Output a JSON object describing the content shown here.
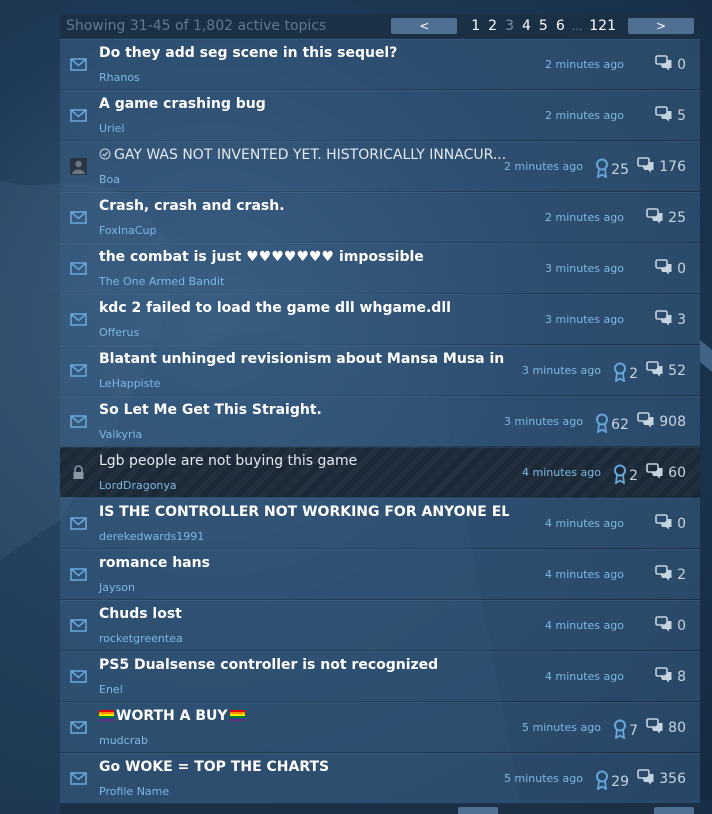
{
  "paging": {
    "summary": "Showing 31-45 of 1,802 active topics",
    "prev_label": "<",
    "next_label": ">",
    "pages": [
      "1",
      "2",
      "3",
      "4",
      "5",
      "6"
    ],
    "current_page": "3",
    "ellipsis": "...",
    "last_page": "121"
  },
  "colors": {
    "accent": "#4f6f93",
    "link": "#7fb8e0",
    "row_bg": "#385e85"
  },
  "topics": [
    {
      "icon": "envelope-icon",
      "title": "Do they add seg scene in this sequel?",
      "author": "Rhanos",
      "time": "2 minutes ago",
      "replies": "0"
    },
    {
      "icon": "envelope-icon",
      "title": "A game crashing bug",
      "author": "Uriel",
      "time": "2 minutes ago",
      "replies": "5"
    },
    {
      "icon": "avatar-icon",
      "title": "GAY WAS NOT INVENTED YET. HISTORICALLY INNACUR...",
      "author": "Boa",
      "time": "2 minutes ago",
      "awards": "25",
      "replies": "176",
      "check": true,
      "normal_weight": true
    },
    {
      "icon": "envelope-icon",
      "title": "Crash, crash and crash.",
      "author": "FoxInaCup",
      "time": "2 minutes ago",
      "replies": "25"
    },
    {
      "icon": "envelope-icon",
      "title": "the combat is just ♥♥♥♥♥♥♥ impossible",
      "author": "The One Armed Bandit",
      "time": "3 minutes ago",
      "replies": "0"
    },
    {
      "icon": "envelope-icon",
      "title": "kdc 2 failed to load the game dll whgame.dll",
      "author": "Offerus",
      "time": "3 minutes ago",
      "replies": "3"
    },
    {
      "icon": "envelope-icon",
      "title": "Blatant unhinged revisionism about Mansa Musa in the game",
      "author": "LeHappiste",
      "time": "3 minutes ago",
      "awards": "2",
      "replies": "52"
    },
    {
      "icon": "envelope-icon",
      "title": "So Let Me Get This Straight.",
      "author": "Valkyria",
      "time": "3 minutes ago",
      "awards": "62",
      "replies": "908"
    },
    {
      "icon": "lock-icon",
      "title": "Lgb people are not buying this game",
      "author": "LordDragonya",
      "time": "4 minutes ago",
      "awards": "2",
      "replies": "60",
      "locked": true,
      "normal_weight": true
    },
    {
      "icon": "envelope-icon",
      "title": "IS THE CONTROLLER NOT WORKING FOR ANYONE ELSE?",
      "author": "derekedwards1991",
      "time": "4 minutes ago",
      "replies": "0"
    },
    {
      "icon": "envelope-icon",
      "title": "romance hans",
      "author": "Jayson",
      "time": "4 minutes ago",
      "replies": "2"
    },
    {
      "icon": "envelope-icon",
      "title": "Chuds lost",
      "author": "rocketgreentea",
      "time": "4 minutes ago",
      "replies": "0"
    },
    {
      "icon": "envelope-icon",
      "title": "PS5 Dualsense controller is not recognized",
      "author": "Enel",
      "time": "4 minutes ago",
      "replies": "8"
    },
    {
      "icon": "envelope-icon",
      "title": "WORTH A BUY",
      "author": "mudcrab",
      "time": "5 minutes ago",
      "awards": "7",
      "replies": "80",
      "flags": true
    },
    {
      "icon": "envelope-icon",
      "title": "Go WOKE = TOP THE CHARTS",
      "author": "Profile Name",
      "time": "5 minutes ago",
      "awards": "29",
      "replies": "356"
    }
  ]
}
